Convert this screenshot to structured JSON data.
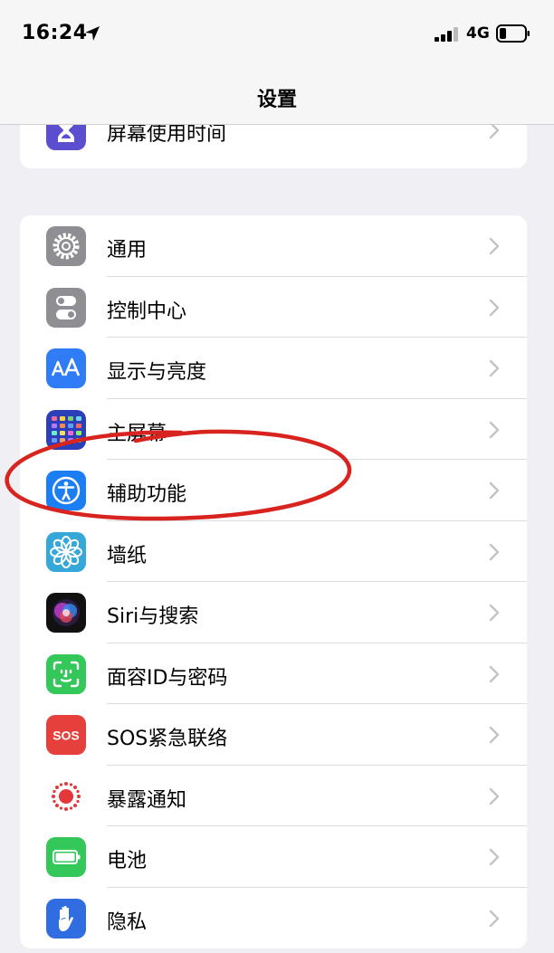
{
  "status": {
    "time": "16:24",
    "network": "4G"
  },
  "nav": {
    "title": "设置"
  },
  "top_group": {
    "label": "屏幕使用时间"
  },
  "main_group": [
    {
      "label": "通用"
    },
    {
      "label": "控制中心"
    },
    {
      "label": "显示与亮度"
    },
    {
      "label": "主屏幕"
    },
    {
      "label": "辅助功能"
    },
    {
      "label": "墙纸"
    },
    {
      "label": "Siri与搜索"
    },
    {
      "label": "面容ID与密码"
    },
    {
      "label": "SOS紧急联络"
    },
    {
      "label": "暴露通知"
    },
    {
      "label": "电池"
    },
    {
      "label": "隐私"
    }
  ],
  "icons": {
    "screen_time": "hourglass-icon",
    "general": "gear-icon",
    "control_center": "toggles-icon",
    "display": "text-size-icon",
    "home_screen": "app-grid-icon",
    "accessibility": "accessibility-icon",
    "wallpaper": "flower-icon",
    "siri": "siri-icon",
    "face_id": "face-id-icon",
    "sos": "sos-icon",
    "exposure": "exposure-notification-icon",
    "battery": "battery-icon",
    "privacy": "hand-icon"
  },
  "colors": {
    "annotation": "#d8231f",
    "screen_time": "#5b4ecf",
    "general": "#8e8e93",
    "display": "#2f7cf6",
    "accessibility": "#1c7ef3",
    "wallpaper": "#35a7d8",
    "face_id": "#34c759",
    "sos": "#e5403b",
    "battery": "#34c759",
    "privacy": "#2f6de0"
  }
}
